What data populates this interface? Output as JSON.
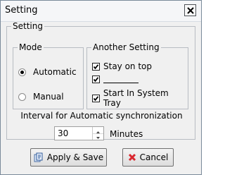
{
  "window": {
    "title": "Setting"
  },
  "setting_group": {
    "legend": "Setting"
  },
  "mode": {
    "legend": "Mode",
    "options": [
      {
        "label": "Automatic",
        "selected": true
      },
      {
        "label": "Manual",
        "selected": false
      }
    ]
  },
  "another": {
    "legend": "Another Setting",
    "items": [
      {
        "label": "Stay on top",
        "checked": true
      },
      {
        "label": "",
        "checked": true
      },
      {
        "label": "Start In System Tray",
        "checked": true
      }
    ]
  },
  "interval": {
    "label": "Interval for Automatic synchronization",
    "value": "30",
    "unit": "Minutes"
  },
  "buttons": {
    "apply_label": "Apply & Save",
    "cancel_label": "Cancel"
  },
  "icons": {
    "close": "close-icon",
    "apply": "apply-save-icon",
    "cancel": "cancel-x-icon",
    "check": "checkmark-icon"
  },
  "colors": {
    "cancel_x": "#d9262e"
  }
}
